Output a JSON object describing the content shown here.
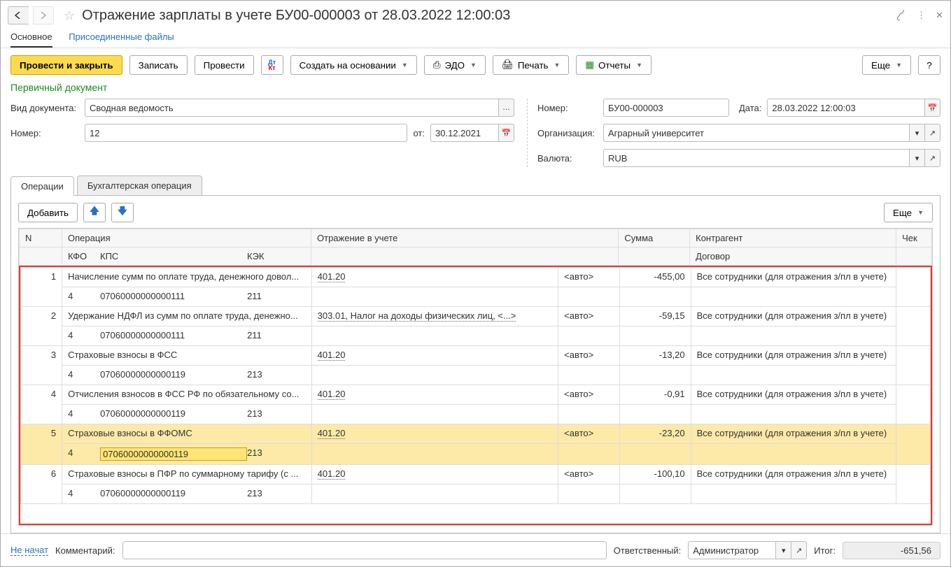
{
  "title": "Отражение зарплаты в учете БУ00-000003 от 28.03.2022 12:00:03",
  "nav": {
    "main": "Основное",
    "attachments": "Присоединенные файлы"
  },
  "toolbar": {
    "post_close": "Провести и закрыть",
    "save": "Записать",
    "post": "Провести",
    "create_based": "Создать на основании",
    "edo": "ЭДО",
    "print": "Печать",
    "reports": "Отчеты",
    "more": "Еще"
  },
  "section": "Первичный документ",
  "form": {
    "doc_type_label": "Вид документа:",
    "doc_type": "Сводная ведомость",
    "src_num_label": "Номер:",
    "src_num": "12",
    "from_label": "от:",
    "from_date": "30.12.2021",
    "num_label": "Номер:",
    "num": "БУ00-000003",
    "date_label": "Дата:",
    "date": "28.03.2022 12:00:03",
    "org_label": "Организация:",
    "org": "Аграрный университет",
    "currency_label": "Валюта:",
    "currency": "RUB"
  },
  "tabs": {
    "ops": "Операции",
    "accounting": "Бухгалтерская операция"
  },
  "ops_toolbar": {
    "add": "Добавить",
    "more": "Еще"
  },
  "columns": {
    "n": "N",
    "operation": "Операция",
    "kfo": "КФО",
    "kps": "КПС",
    "kek": "КЭК",
    "reflection": "Отражение в учете",
    "sum": "Сумма",
    "contractor": "Контрагент",
    "contract": "Договор",
    "cheque": "Чек"
  },
  "rows": [
    {
      "n": 1,
      "operation": "Начисление сумм по оплате труда, денежного довол...",
      "kfo": "4",
      "kps": "07060000000000111",
      "kek": "211",
      "reflection": "401.20",
      "auto": "<авто>",
      "sum": "-455,00",
      "contractor": "Все сотрудники (для отражения з/пл в учете)"
    },
    {
      "n": 2,
      "operation": "Удержание НДФЛ из сумм по оплате труда, денежно...",
      "kfo": "4",
      "kps": "07060000000000111",
      "kek": "211",
      "reflection": "303.01, Налог на доходы физических лиц, <...>",
      "auto": "<авто>",
      "sum": "-59,15",
      "contractor": "Все сотрудники (для отражения з/пл в учете)"
    },
    {
      "n": 3,
      "operation": "Страховые взносы в ФСС",
      "kfo": "4",
      "kps": "07060000000000119",
      "kek": "213",
      "reflection": "401.20",
      "auto": "<авто>",
      "sum": "-13,20",
      "contractor": "Все сотрудники (для отражения з/пл в учете)"
    },
    {
      "n": 4,
      "operation": "Отчисления взносов в ФСС РФ по обязательному со...",
      "kfo": "4",
      "kps": "07060000000000119",
      "kek": "213",
      "reflection": "401.20",
      "auto": "<авто>",
      "sum": "-0,91",
      "contractor": "Все сотрудники (для отражения з/пл в учете)"
    },
    {
      "n": 5,
      "operation": "Страховые взносы в ФФОМС",
      "kfo": "4",
      "kps": "07060000000000119",
      "kek": "213",
      "reflection": "401.20",
      "auto": "<авто>",
      "sum": "-23,20",
      "contractor": "Все сотрудники (для отражения з/пл в учете)",
      "selected": true
    },
    {
      "n": 6,
      "operation": "Страховые взносы в ПФР по суммарному тарифу (с ...",
      "kfo": "4",
      "kps": "07060000000000119",
      "kek": "213",
      "reflection": "401.20",
      "auto": "<авто>",
      "sum": "-100,10",
      "contractor": "Все сотрудники (для отражения з/пл в учете)"
    }
  ],
  "footer": {
    "status": "Не начат",
    "comment_label": "Комментарий:",
    "comment": "",
    "responsible_label": "Ответственный:",
    "responsible": "Администратор",
    "total_label": "Итог:",
    "total": "-651,56"
  }
}
